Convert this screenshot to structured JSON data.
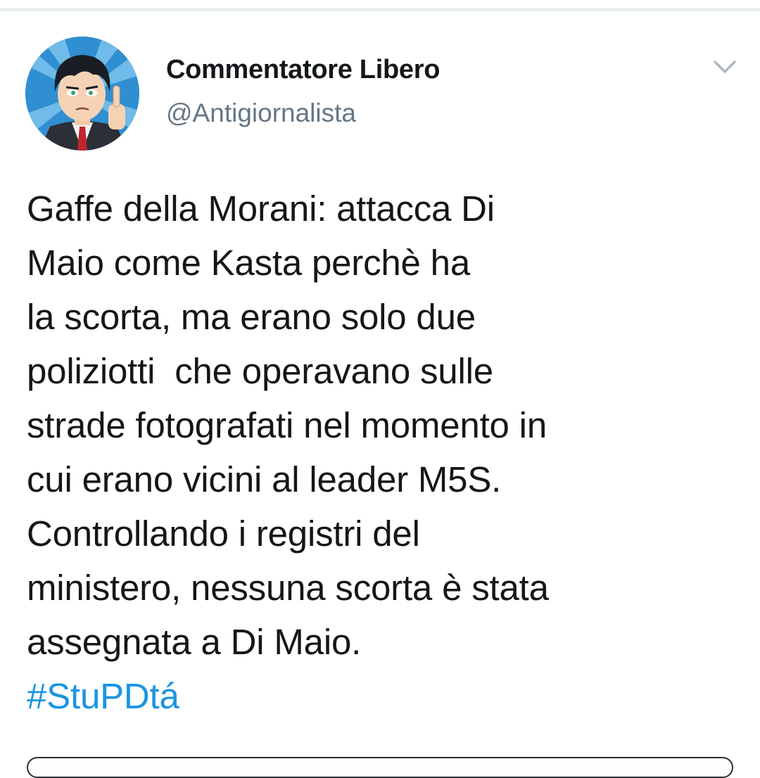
{
  "tweet": {
    "author": {
      "display_name": "Commentatore Libero",
      "handle": "@Antigiornalista",
      "avatar_icon": "cartoon-avatar-middle-finger"
    },
    "menu_icon": "chevron-down-icon",
    "text_lines": [
      "Gaffe della Morani: attacca Di",
      "Maio come Kasta perchè ha",
      "la scorta, ma erano solo due",
      "poliziotti  che operavano sulle",
      "strade fotografati nel momento in",
      "cui erano vicini al leader M5S.",
      "Controllando i registri del",
      "ministero, nessuna scorta è stata",
      "assegnata a Di Maio."
    ],
    "hashtag": "#StuPDtá"
  },
  "colors": {
    "text": "#14171a",
    "secondary": "#657786",
    "link": "#1b95e0",
    "chevron": "#aab8c2",
    "divider": "#e6ecf0"
  }
}
